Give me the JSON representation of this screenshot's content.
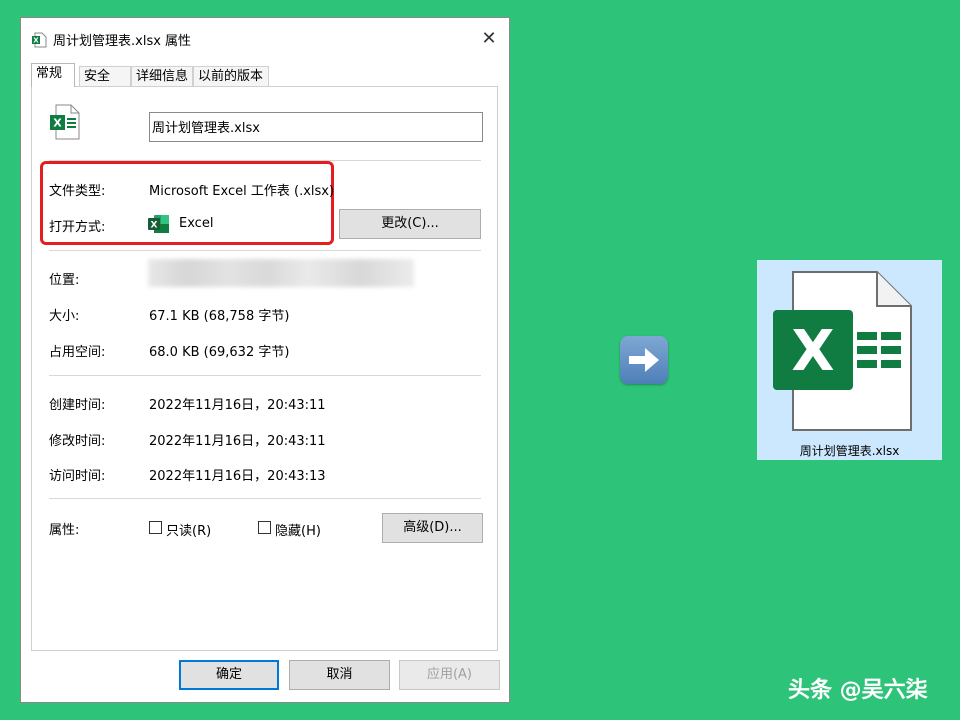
{
  "window": {
    "title": "周计划管理表.xlsx 属性"
  },
  "tabs": [
    {
      "label": "常规"
    },
    {
      "label": "安全"
    },
    {
      "label": "详细信息"
    },
    {
      "label": "以前的版本"
    }
  ],
  "general": {
    "file_name": "周计划管理表.xlsx",
    "file_type_label": "文件类型:",
    "file_type_value": "Microsoft Excel 工作表 (.xlsx)",
    "opens_with_label": "打开方式:",
    "opens_with_value": "Excel",
    "change_button": "更改(C)...",
    "location_label": "位置:",
    "size_label": "大小:",
    "size_value": "67.1 KB (68,758 字节)",
    "size_on_disk_label": "占用空间:",
    "size_on_disk_value": "68.0 KB (69,632 字节)",
    "created_label": "创建时间:",
    "created_value": "2022年11月16日，20:43:11",
    "modified_label": "修改时间:",
    "modified_value": "2022年11月16日，20:43:11",
    "accessed_label": "访问时间:",
    "accessed_value": "2022年11月16日，20:43:13",
    "attributes_label": "属性:",
    "readonly_label": "只读(R)",
    "readonly_checked": false,
    "hidden_label": "隐藏(H)",
    "hidden_checked": false,
    "advanced_button": "高级(D)..."
  },
  "footer": {
    "ok": "确定",
    "cancel": "取消",
    "apply": "应用(A)"
  },
  "result_tile": {
    "caption": "周计划管理表.xlsx"
  },
  "watermark": "头条 @吴六柒",
  "colors": {
    "background": "#2dc378",
    "highlight_box": "#e41e1e",
    "excel_green": "#107c41",
    "tile_bg": "#cce8ff"
  },
  "icons": [
    "excel-file-icon",
    "close-icon",
    "excel-app-icon",
    "right-arrow-icon",
    "excel-large-file-icon"
  ]
}
